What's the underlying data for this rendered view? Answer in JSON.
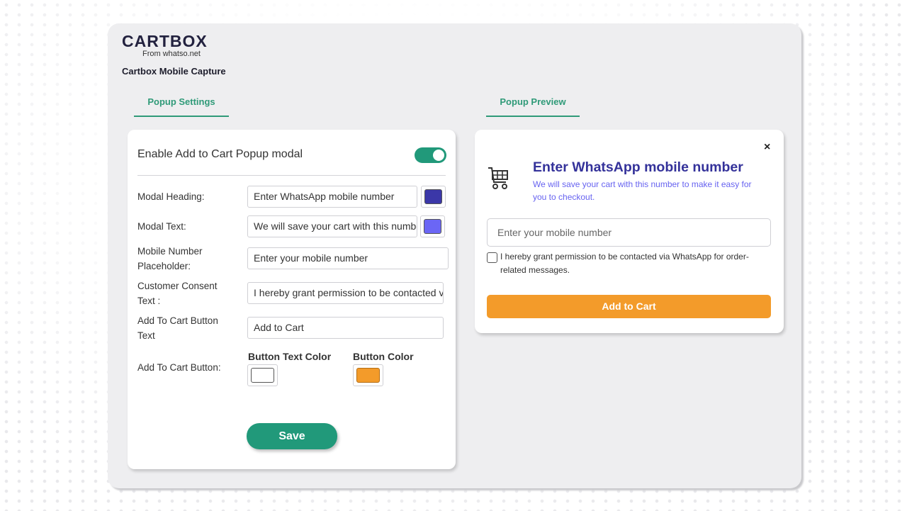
{
  "brand": {
    "logo_text": "CARTBOX",
    "logo_sub": "From whatso.net"
  },
  "app_title": "Cartbox Mobile Capture",
  "tabs": {
    "settings": "Popup Settings",
    "preview": "Popup Preview"
  },
  "settings": {
    "enable_label": "Enable Add to Cart Popup modal",
    "enable_on": true,
    "fields": {
      "modal_heading": {
        "label": "Modal Heading:",
        "value": "Enter WhatsApp mobile number",
        "color": "#3b37a8"
      },
      "modal_text": {
        "label": "Modal Text:",
        "value": "We will save your cart with this number to make it easy for you to checkout.",
        "color": "#6b66f5"
      },
      "mobile_placeholder": {
        "label_1": "Mobile Number",
        "label_2": "Placeholder:",
        "value": "Enter your mobile number"
      },
      "consent": {
        "label_1": "Customer Consent",
        "label_2": "Text :",
        "value": "I hereby grant permission to be contacted via WhatsApp for order-related messages."
      },
      "button_text": {
        "label_1": "Add To Cart Button",
        "label_2": "Text",
        "value": "Add to Cart"
      },
      "button_colors": {
        "label": "Add To Cart Button:",
        "text_color_label": "Button Text Color",
        "text_color": "#ffffff",
        "button_color_label": "Button Color",
        "button_color": "#f39b2a"
      }
    },
    "save_label": "Save"
  },
  "preview": {
    "close": "×",
    "heading": "Enter WhatsApp mobile number",
    "text": "We will save your cart with this number to make it easy for you to checkout.",
    "input_placeholder": "Enter your mobile number",
    "consent": "I hereby grant permission to be contacted via WhatsApp for order-related messages.",
    "button": "Add to Cart"
  },
  "colors": {
    "accent": "#21997a",
    "tab_text": "#2f9a78"
  },
  "icons": {
    "cart": "shopping-cart-icon",
    "close": "close-icon"
  }
}
